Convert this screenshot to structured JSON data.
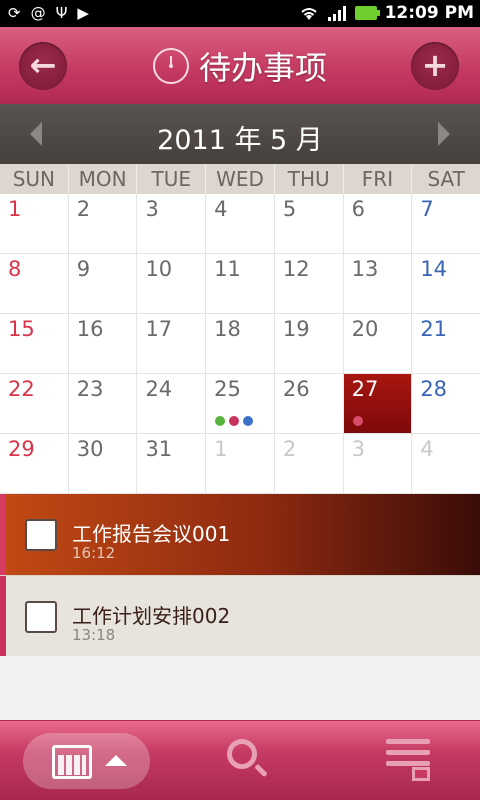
{
  "status_bar": {
    "time": "12:09 PM",
    "icons": [
      "sync-icon",
      "at-icon",
      "usb-icon",
      "play-icon",
      "wifi-icon",
      "signal-icon",
      "battery-icon"
    ]
  },
  "header": {
    "title": "待办事项",
    "back_icon": "arrow-left-icon",
    "add_icon": "plus-icon",
    "title_icon": "clock-icon"
  },
  "month_nav": {
    "title": "2011 年 5 月"
  },
  "weekdays": [
    "SUN",
    "MON",
    "TUE",
    "WED",
    "THU",
    "FRI",
    "SAT"
  ],
  "calendar": {
    "weeks": [
      [
        {
          "day": "1",
          "type": "sun"
        },
        {
          "day": "2"
        },
        {
          "day": "3"
        },
        {
          "day": "4"
        },
        {
          "day": "5"
        },
        {
          "day": "6"
        },
        {
          "day": "7",
          "type": "sat"
        }
      ],
      [
        {
          "day": "8",
          "type": "sun"
        },
        {
          "day": "9"
        },
        {
          "day": "10"
        },
        {
          "day": "11"
        },
        {
          "day": "12"
        },
        {
          "day": "13"
        },
        {
          "day": "14",
          "type": "sat"
        }
      ],
      [
        {
          "day": "15",
          "type": "sun"
        },
        {
          "day": "16"
        },
        {
          "day": "17"
        },
        {
          "day": "18"
        },
        {
          "day": "19"
        },
        {
          "day": "20"
        },
        {
          "day": "21",
          "type": "sat"
        }
      ],
      [
        {
          "day": "22",
          "type": "sun"
        },
        {
          "day": "23"
        },
        {
          "day": "24"
        },
        {
          "day": "25",
          "dots": [
            "green",
            "red",
            "blue"
          ]
        },
        {
          "day": "26"
        },
        {
          "day": "27",
          "selected": true,
          "dots": [
            "pink"
          ]
        },
        {
          "day": "28",
          "type": "sat"
        }
      ],
      [
        {
          "day": "29",
          "type": "sun"
        },
        {
          "day": "30"
        },
        {
          "day": "31"
        },
        {
          "day": "1",
          "type": "other"
        },
        {
          "day": "2",
          "type": "other"
        },
        {
          "day": "3",
          "type": "other"
        },
        {
          "day": "4",
          "type": "other"
        }
      ]
    ]
  },
  "tasks": [
    {
      "title": "工作报告会议001",
      "time": "16:12",
      "active": true,
      "checked": false
    },
    {
      "title": "工作计划安排002",
      "time": "13:18",
      "active": false,
      "checked": false
    }
  ],
  "bottom_nav": {
    "items": [
      "calendar-tab",
      "search-tab",
      "list-tab"
    ]
  }
}
